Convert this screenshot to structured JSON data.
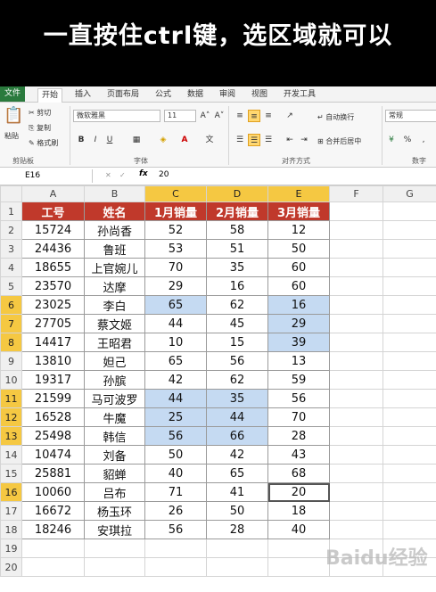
{
  "caption": "一直按住ctrl键，选区域就可以",
  "ribbon_tabs": [
    "文件",
    "开始",
    "插入",
    "页面布局",
    "公式",
    "数据",
    "审阅",
    "视图",
    "开发工具"
  ],
  "ribbon": {
    "cut": "剪切",
    "copy": "复制",
    "paste": "粘贴",
    "format_painter": "格式刷",
    "clipboard_group": "剪贴板",
    "font_name": "微软雅黑",
    "font_size": "11",
    "font_group": "字体",
    "bold": "B",
    "italic": "I",
    "underline": "U",
    "wrap_text": "自动换行",
    "merge_center": "合并后居中",
    "align_group": "对齐方式",
    "number_format": "常规",
    "number_group": "数字"
  },
  "formula_bar": {
    "name_box": "E16",
    "fx": "fx",
    "content": "20"
  },
  "columns": [
    "A",
    "B",
    "C",
    "D",
    "E",
    "F",
    "G"
  ],
  "selected_columns": [
    "C",
    "D",
    "E"
  ],
  "row_numbers": [
    "1",
    "2",
    "3",
    "4",
    "5",
    "6",
    "7",
    "8",
    "9",
    "10",
    "11",
    "12",
    "13",
    "14",
    "15",
    "16",
    "17",
    "18",
    "19",
    "20"
  ],
  "selected_rows": [
    "6",
    "7",
    "8",
    "11",
    "12",
    "13",
    "16"
  ],
  "headers": [
    "工号",
    "姓名",
    "1月销量",
    "2月销量",
    "3月销量"
  ],
  "rows": [
    [
      "15724",
      "孙尚香",
      "52",
      "58",
      "12"
    ],
    [
      "24436",
      "鲁班",
      "53",
      "51",
      "50"
    ],
    [
      "18655",
      "上官婉儿",
      "70",
      "35",
      "60"
    ],
    [
      "23570",
      "达摩",
      "29",
      "16",
      "60"
    ],
    [
      "23025",
      "李白",
      "65",
      "62",
      "16"
    ],
    [
      "27705",
      "蔡文姬",
      "44",
      "45",
      "29"
    ],
    [
      "14417",
      "王昭君",
      "10",
      "15",
      "39"
    ],
    [
      "13810",
      "妲己",
      "65",
      "56",
      "13"
    ],
    [
      "19317",
      "孙膑",
      "42",
      "62",
      "59"
    ],
    [
      "21599",
      "马可波罗",
      "44",
      "35",
      "56"
    ],
    [
      "16528",
      "牛魔",
      "25",
      "44",
      "70"
    ],
    [
      "25498",
      "韩信",
      "56",
      "66",
      "28"
    ],
    [
      "10474",
      "刘备",
      "50",
      "42",
      "43"
    ],
    [
      "25881",
      "貂蝉",
      "40",
      "65",
      "68"
    ],
    [
      "10060",
      "吕布",
      "71",
      "41",
      "20"
    ],
    [
      "16672",
      "杨玉环",
      "26",
      "50",
      "18"
    ],
    [
      "18246",
      "安琪拉",
      "56",
      "28",
      "40"
    ]
  ],
  "watermark": "Baidu经验"
}
